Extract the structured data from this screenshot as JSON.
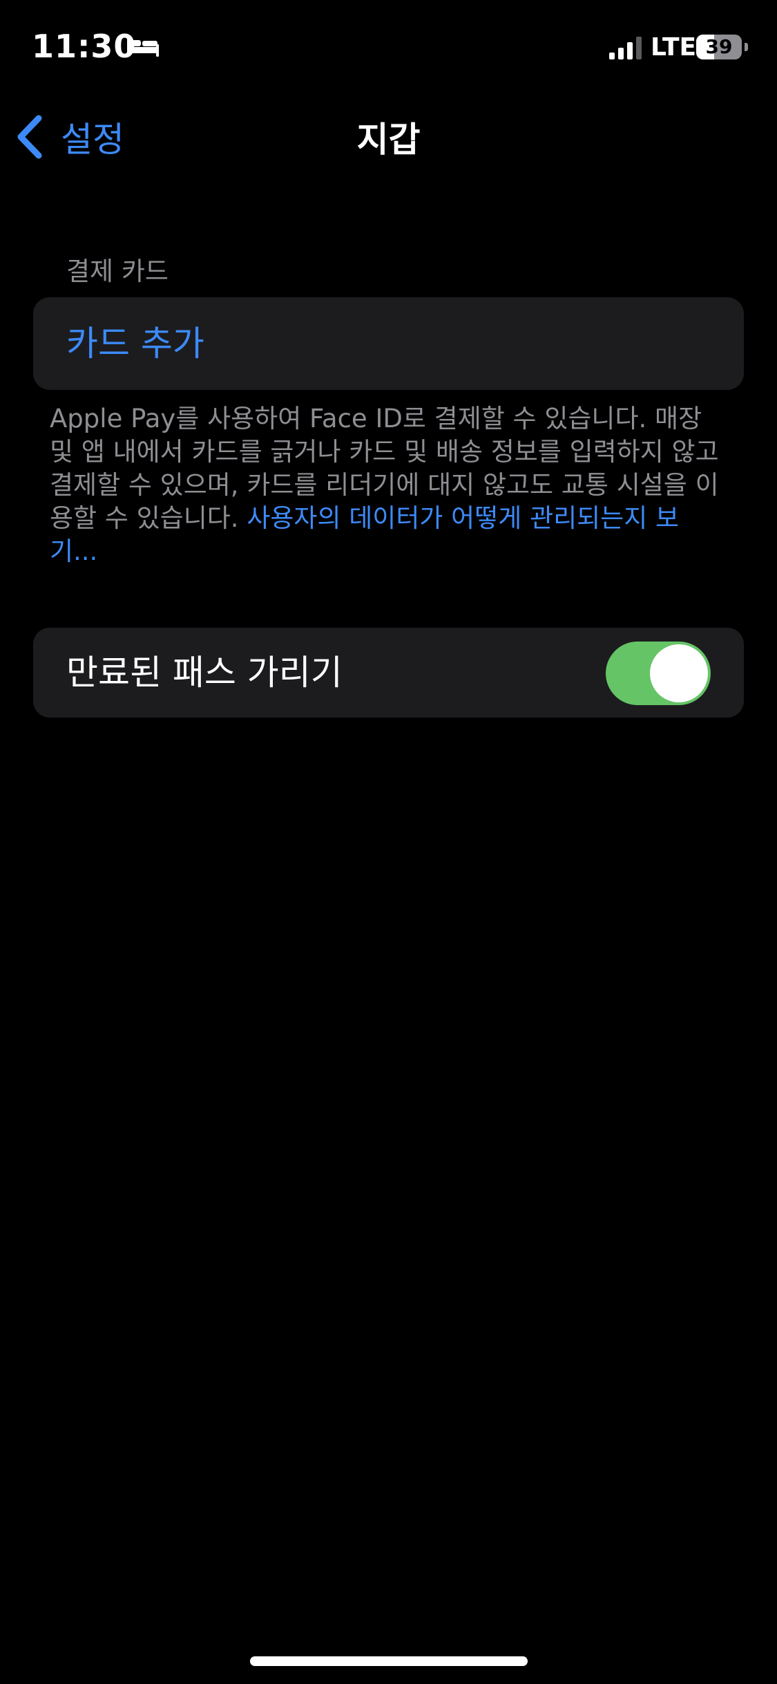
{
  "status_bar": {
    "time": "11:30",
    "focus_icon": "bed-icon",
    "signal_icon": "cellular-signal-icon",
    "network": "LTE",
    "battery_level": "39",
    "battery_fraction": 0.39
  },
  "nav": {
    "back_label": "설정",
    "back_icon": "chevron-left-icon",
    "title": "지갑"
  },
  "payment_section": {
    "header": "결제 카드",
    "add_card_label": "카드 추가",
    "footer_text": "Apple Pay를 사용하여 Face ID로 결제할 수 있습니다. 매장 및 앱 내에서 카드를 긁거나 카드 및 배송 정보를 입력하지 않고 결제할 수 있으며, 카드를 리더기에 대지 않고도 교통 시설을 이용할 수 있습니다.",
    "footer_link": "사용자의 데이터가 어떻게 관리되는지 보기..."
  },
  "passes_section": {
    "hide_expired_label": "만료된 패스 가리기",
    "hide_expired_on": true
  },
  "colors": {
    "background": "#000000",
    "group_background": "#1c1c1e",
    "accent_blue": "#3d8af7",
    "secondary_text": "#8e8e93",
    "toggle_on": "#65c466"
  }
}
